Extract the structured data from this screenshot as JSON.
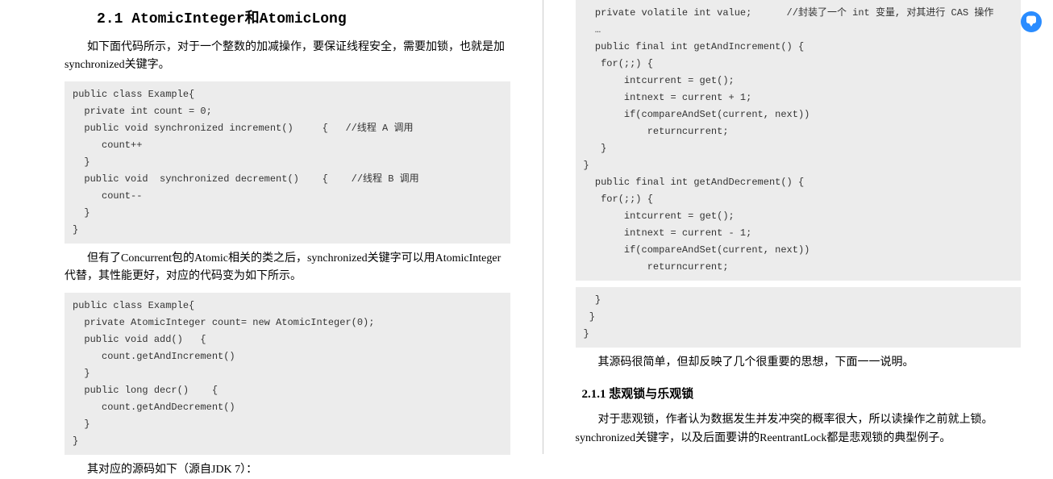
{
  "left": {
    "heading": "2.1 AtomicInteger和AtomicLong",
    "para1": "如下面代码所示，对于一个整数的加减操作，要保证线程安全，需要加锁，也就是加synchronized关键字。",
    "code1": "public class Example{\n  private int count = 0;\n  public void synchronized increment()     {   //线程 A 调用\n     count++\n  }\n  public void  synchronized decrement()    {    //线程 B 调用\n     count--\n  }\n}",
    "para2": "但有了Concurrent包的Atomic相关的类之后，synchronized关键字可以用AtomicInteger代替，其性能更好，对应的代码变为如下所示。",
    "code2": "public class Example{\n  private AtomicInteger count= new AtomicInteger(0);\n  public void add()   {\n     count.getAndIncrement()\n  }\n  public long decr()    {\n     count.getAndDecrement()\n  }\n}",
    "para3": "其对应的源码如下（源自JDK 7）："
  },
  "right": {
    "code1": "  private volatile int value;      //封装了一个 int 变量, 对其进行 CAS 操作\n  …\n  public final int getAndIncrement() {\n   for(;;) {\n       intcurrent = get();\n       intnext = current + 1;\n       if(compareAndSet(current, next))\n           returncurrent;\n   }\n}\n  public final int getAndDecrement() {\n   for(;;) {\n       intcurrent = get();\n       intnext = current - 1;\n       if(compareAndSet(current, next))\n           returncurrent;",
    "code2": "  }\n }\n}",
    "para1": "其源码很简单，但却反映了几个很重要的思想，下面一一说明。",
    "subheading": "2.1.1 悲观锁与乐观锁",
    "para2": "对于悲观锁，作者认为数据发生并发冲突的概率很大，所以读操作之前就上锁。synchronized关键字，以及后面要讲的ReentrantLock都是悲观锁的典型例子。"
  },
  "badge": {
    "name": "ai-chat-icon"
  }
}
